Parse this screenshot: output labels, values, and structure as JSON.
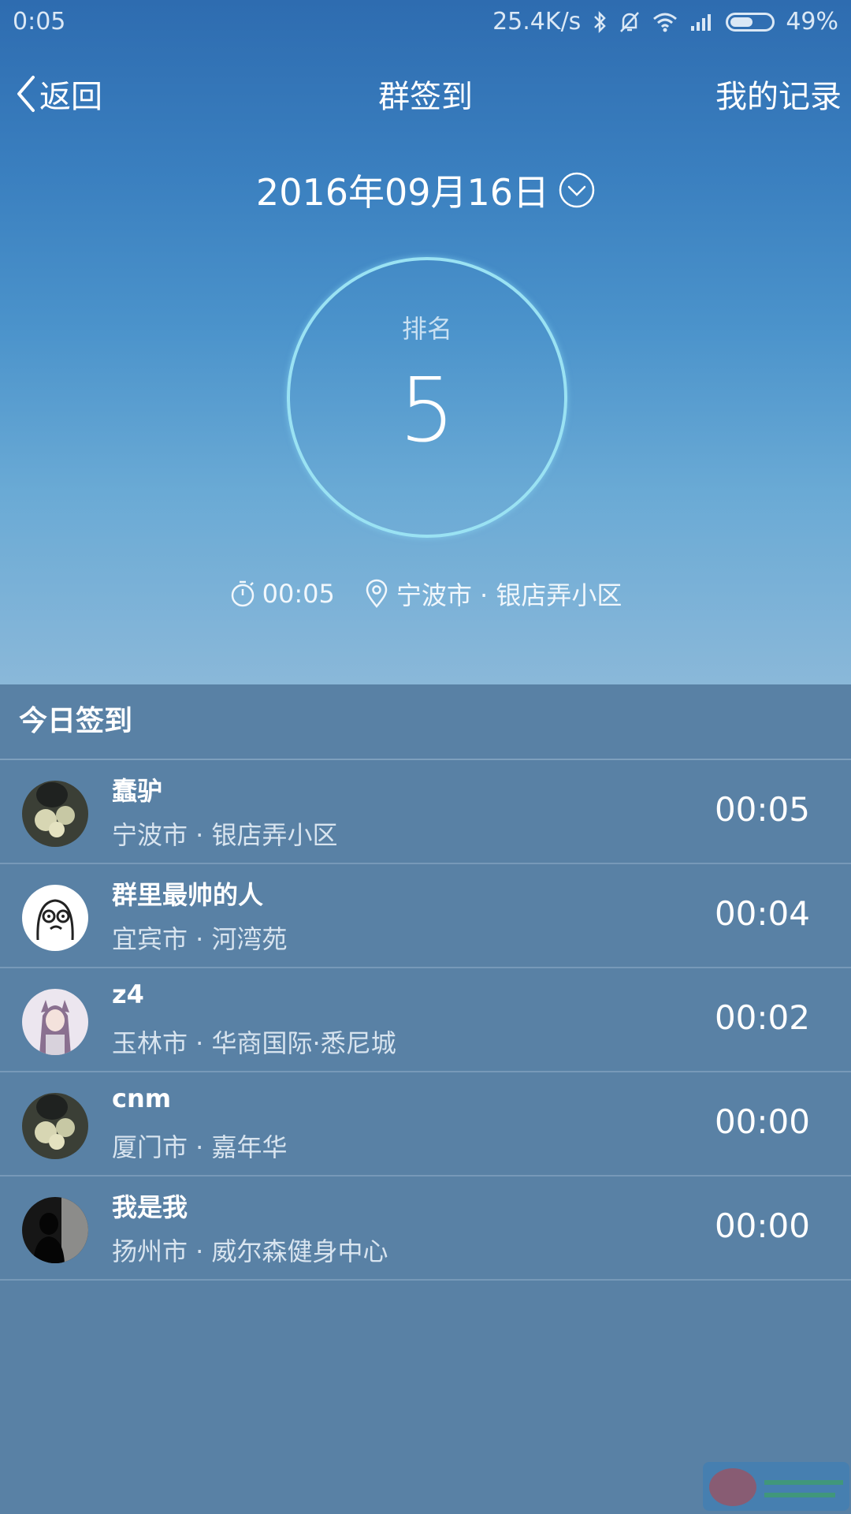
{
  "status_bar": {
    "time": "0:05",
    "net_speed": "25.4K/s",
    "battery": "49%",
    "battery_level": 0.49,
    "icons": [
      "bluetooth-icon",
      "mute-bell-icon",
      "wifi-icon",
      "signal-icon",
      "battery-icon"
    ]
  },
  "nav": {
    "back_label": "返回",
    "title": "群签到",
    "records_label": "我的记录"
  },
  "date": {
    "text": "2016年09月16日"
  },
  "rank": {
    "label": "排名",
    "value": "5"
  },
  "checkin": {
    "time": "00:05",
    "location": "宁波市 · 银店弄小区"
  },
  "list": {
    "header": "今日签到",
    "rows": [
      {
        "name": "蠢驴",
        "location": "宁波市 · 银店弄小区",
        "time": "00:05",
        "avatar": "avatar-photo-flowers"
      },
      {
        "name": "群里最帅的人",
        "location": "宜宾市 · 河湾苑",
        "time": "00:04",
        "avatar": "avatar-cartoon-face"
      },
      {
        "name": "z4",
        "location": "玉林市 · 华商国际·悉尼城",
        "time": "00:02",
        "avatar": "avatar-anime-girl"
      },
      {
        "name": "cnm",
        "location": "厦门市 · 嘉年华",
        "time": "00:00",
        "avatar": "avatar-photo-flowers"
      },
      {
        "name": "我是我",
        "location": "扬州市 · 威尔森健身中心",
        "time": "00:00",
        "avatar": "avatar-dark-silhouette"
      }
    ]
  },
  "colors": {
    "hero_top": "#2e6cb0",
    "hero_bottom": "#8ab8d9",
    "list_bg": "#5981a5",
    "ring": "#9ae2f3"
  }
}
